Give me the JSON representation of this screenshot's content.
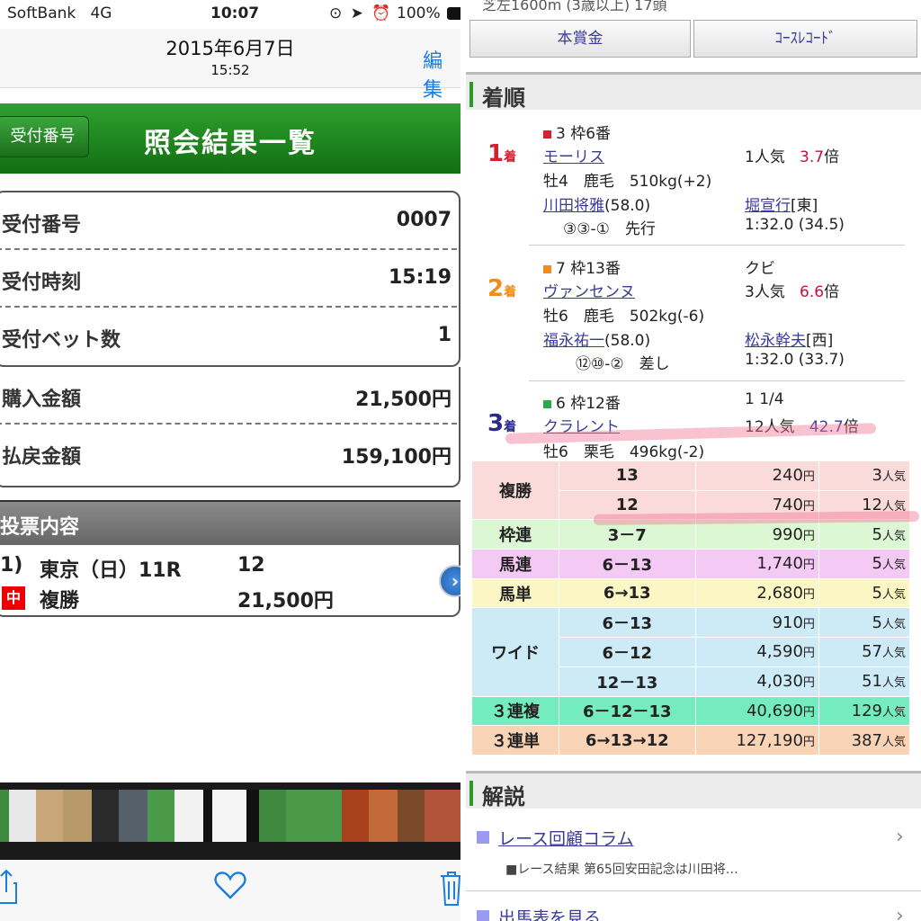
{
  "left": {
    "status_bar": {
      "carrier": "SoftBank",
      "network": "4G",
      "time": "10:07",
      "battery": "100%"
    },
    "header": {
      "date": "2015年6月7日",
      "time": "15:52",
      "edit": "編集"
    },
    "green_bar": {
      "button": "受付番号",
      "title": "照会結果一覧"
    },
    "info": [
      {
        "label": "受付番号",
        "value": "0007"
      },
      {
        "label": "受付時刻",
        "value": "15:19"
      },
      {
        "label": "受付ベット数",
        "value": "1"
      },
      {
        "label": "購入金額",
        "value": "21,500円"
      },
      {
        "label": "払戻金額",
        "value": "159,100円"
      }
    ],
    "bet": {
      "header": "投票内容",
      "col1": "1)",
      "venue": "東京（日）11R",
      "number": "12",
      "hit": "中",
      "type": "複勝",
      "amount": "21,500円"
    },
    "toolbar": {
      "share_icon": "share-icon",
      "heart_icon": "heart-icon",
      "trash_icon": "trash-icon"
    }
  },
  "right": {
    "top_clip": "芝左1600m (3歳以上) 17頭",
    "buttons": [
      "本賞金",
      "ｺｰｽﾚｺｰﾄﾞ"
    ],
    "results_header": "着順",
    "finishers": [
      {
        "place": "1",
        "place_suffix": "着",
        "place_color": "#d42030",
        "frame_color": "#d42030",
        "frame": "3 枠6番",
        "margin": "",
        "name": "モーリス",
        "popularity": "1人気",
        "odds": "3.7",
        "odds_unit": "倍",
        "sex_age_color_weight": "牡4　鹿毛　510kg(+2)",
        "jockey": "川田将雅",
        "jockey_weight": "(58.0)",
        "trainer": "堀宣行",
        "trainer_region": "[東]",
        "position": "③③-①　先行",
        "time": "1:32.0 (34.5)"
      },
      {
        "place": "2",
        "place_suffix": "着",
        "place_color": "#f08c1a",
        "frame_color": "#f08c1a",
        "frame": "7 枠13番",
        "margin": "クビ",
        "name": "ヴァンセンヌ",
        "popularity": "3人気",
        "odds": "6.6",
        "odds_unit": "倍",
        "sex_age_color_weight": "牡6　鹿毛　502kg(-6)",
        "jockey": "福永祐一",
        "jockey_weight": "(58.0)",
        "trainer": "松永幹夫",
        "trainer_region": "[西]",
        "position": "⑫⑩-②　差し",
        "time": "1:32.0 (33.7)"
      },
      {
        "place": "3",
        "place_suffix": "着",
        "place_color": "#2a2a8a",
        "frame_color": "#2aa84a",
        "frame": "6 枠12番",
        "margin": "1 1/4",
        "name": "クラレント",
        "popularity": "12人気",
        "odds": "42.7",
        "odds_unit": "倍",
        "sex_age_color_weight": "牡6　栗毛　496kg(-2)"
      }
    ],
    "payouts": [
      {
        "ticket": "複勝",
        "combo": "13",
        "payout": "240",
        "pop": "3",
        "bg": "#fbdada"
      },
      {
        "ticket": "",
        "combo": "12",
        "payout": "740",
        "pop": "12",
        "bg": "#fbdada"
      },
      {
        "ticket": "枠連",
        "combo": "3－7",
        "payout": "990",
        "pop": "5",
        "bg": "#dcf7d4"
      },
      {
        "ticket": "馬連",
        "combo": "6－13",
        "payout": "1,740",
        "pop": "5",
        "bg": "#f4c9f4"
      },
      {
        "ticket": "馬単",
        "combo": "6→13",
        "payout": "2,680",
        "pop": "5",
        "bg": "#fbf6c4"
      },
      {
        "ticket": "ワイド",
        "combo": "6－13",
        "payout": "910",
        "pop": "5",
        "bg": "#cdeaf7"
      },
      {
        "ticket": "",
        "combo": "6－12",
        "payout": "4,590",
        "pop": "57",
        "bg": "#cdeaf7"
      },
      {
        "ticket": "",
        "combo": "12－13",
        "payout": "4,030",
        "pop": "51",
        "bg": "#cdeaf7"
      },
      {
        "ticket": "３連複",
        "combo": "6－12－13",
        "payout": "40,690",
        "pop": "129",
        "bg": "#74ecc0"
      },
      {
        "ticket": "３連単",
        "combo": "6→13→12",
        "payout": "127,190",
        "pop": "387",
        "bg": "#f8d3b6"
      }
    ],
    "units": {
      "yen": "円",
      "pop": "人気"
    },
    "commentary_header": "解説",
    "commentary_link": "レース回顧コラム",
    "commentary_snippet": "■レース結果 第65回安田記念は川田将…",
    "entries_link": "出馬表を見る"
  }
}
